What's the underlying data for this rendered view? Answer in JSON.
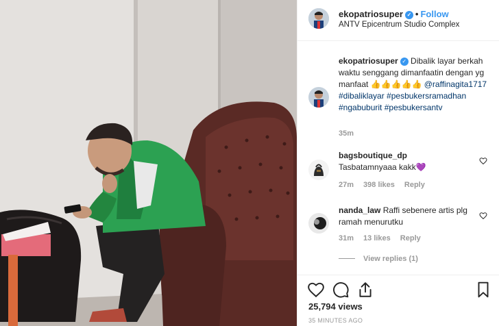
{
  "post": {
    "username": "ekopatriosuper",
    "follow_label": "Follow",
    "separator": "•",
    "location": "ANTV Epicentrum Studio Complex"
  },
  "caption": {
    "username": "ekopatriosuper",
    "text": "Dibalik layar berkah waktu senggang dimanfaatin dengan yg manfaat 👍👍👍👍👍",
    "tags": [
      "@raffinagita1717",
      "#dibaliklayar",
      "#pesbukersramadhan",
      "#ngabuburit",
      "#pesbukersantv"
    ],
    "time": "35m"
  },
  "comments": [
    {
      "username": "bagsboutique_dp",
      "text": "Tasbatamnyaaa kakk💜",
      "time": "27m",
      "likes": "398 likes",
      "reply": "Reply"
    },
    {
      "username": "nanda_law",
      "text": "Raffi sebenere artis plg ramah menurutku",
      "time": "31m",
      "likes": "13 likes",
      "reply": "Reply"
    }
  ],
  "view_replies": "View replies (1)",
  "views": "25,794 views",
  "time_ago": "35 MINUTES AGO",
  "icons": [
    "heart-icon",
    "comment-icon",
    "share-icon",
    "bookmark-icon",
    "verified-icon"
  ],
  "colors": {
    "accent": "#3897f0",
    "hashtag": "#003569",
    "muted": "#999999"
  }
}
